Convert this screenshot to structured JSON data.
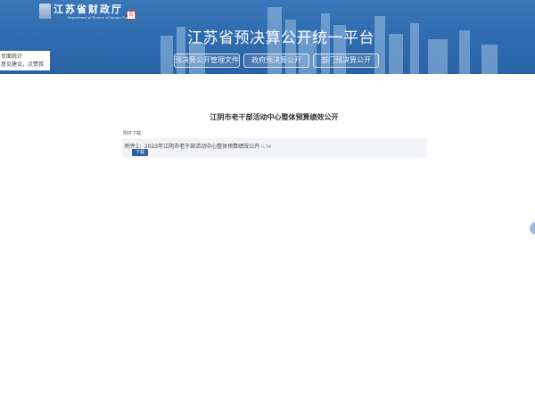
{
  "header": {
    "brand_name": "江苏省财政厅",
    "brand_sub": "Department of Finance of Jiangsu Province",
    "seal_text": "局",
    "site_title": "江苏省预决算公开统一平台"
  },
  "nav": {
    "items": [
      {
        "label": "预决算公开管理文件"
      },
      {
        "label": "政府预决算公开"
      },
      {
        "label": "部门预决算公开"
      }
    ]
  },
  "notice": {
    "lines": [
      "页面统计",
      "意见建议，点赞我"
    ]
  },
  "document": {
    "title": "江阴市老干部活动中心整体预算绩效公开",
    "attachment_label": "附件下载：",
    "attachment_name": "附件1：2023年江阴市老干部活动中心整体预算绩效公开",
    "attachment_size": "0.7M",
    "download_label": "下载"
  },
  "colors": {
    "header_blue": "#2f6db0",
    "download_button": "#2e5f9f",
    "side_handle": "#9fb9e6"
  }
}
